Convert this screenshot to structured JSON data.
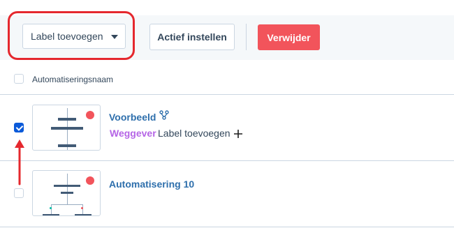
{
  "toolbar": {
    "label_dropdown": "Label toevoegen",
    "actief_button": "Actief instellen",
    "verwijder_button": "Verwijder"
  },
  "table": {
    "column_header": "Automatiseringsnaam",
    "rows": [
      {
        "title": "Voorbeeld",
        "checked": true,
        "tag": "Weggever",
        "add_label": "Label toevoegen"
      },
      {
        "title": "Automatisering 10",
        "checked": false
      }
    ]
  },
  "colors": {
    "accent_blue": "#2e6fac",
    "delete_red": "#f2545b",
    "tag_purple": "#b565e6",
    "annotation_red": "#e5282e",
    "checkbox_blue": "#0b5ad9"
  }
}
